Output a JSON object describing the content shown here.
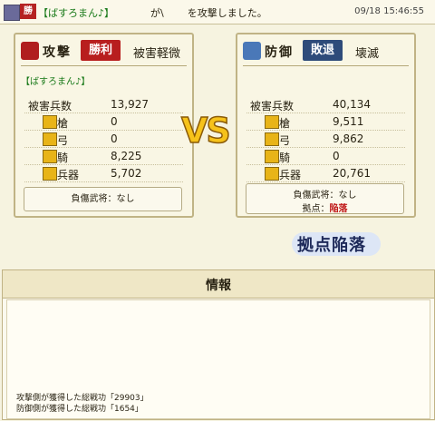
{
  "topbar": {
    "player_link": "【ばすろまん♪】",
    "target": "が\\",
    "message": "を攻撃しました。",
    "timestamp": "09/18 15:46:55",
    "badge": "勝"
  },
  "attacker": {
    "role": "攻撃",
    "result": "勝利",
    "damage_level": "被害軽微",
    "player": "【ばすろまん♪】",
    "casualties_label": "被害兵数",
    "casualties": "13,927",
    "units": [
      {
        "icon": "spear-icon",
        "label": "槍",
        "value": "0"
      },
      {
        "icon": "bow-icon",
        "label": "弓",
        "value": "0"
      },
      {
        "icon": "horse-icon",
        "label": "騎",
        "value": "8,225"
      },
      {
        "icon": "siege-icon",
        "label": "兵器",
        "value": "5,702"
      }
    ],
    "injured_general": "負傷武将：なし"
  },
  "defender": {
    "role": "防御",
    "result": "敗退",
    "damage_level": "壊滅",
    "casualties_label": "被害兵数",
    "casualties": "40,134",
    "units": [
      {
        "icon": "spear-icon",
        "label": "槍",
        "value": "9,511"
      },
      {
        "icon": "bow-icon",
        "label": "弓",
        "value": "9,862"
      },
      {
        "icon": "horse-icon",
        "label": "騎",
        "value": "0"
      },
      {
        "icon": "siege-icon",
        "label": "兵器",
        "value": "20,761"
      }
    ],
    "injured_general": "負傷武将：なし",
    "base_label": "拠点：",
    "base_status": "陥落"
  },
  "vs_text": "VS",
  "fall_banner": "拠点陥落",
  "info": {
    "title": "情報",
    "lines": [
      "攻撃側が獲得した総戦功「29903」",
      "防御側が獲得した総戦功「1654」"
    ]
  },
  "colors": {
    "win": "#b81e1e",
    "lose": "#2e4b7a",
    "link": "#1a7a1a",
    "vs": "#f6c21a"
  }
}
